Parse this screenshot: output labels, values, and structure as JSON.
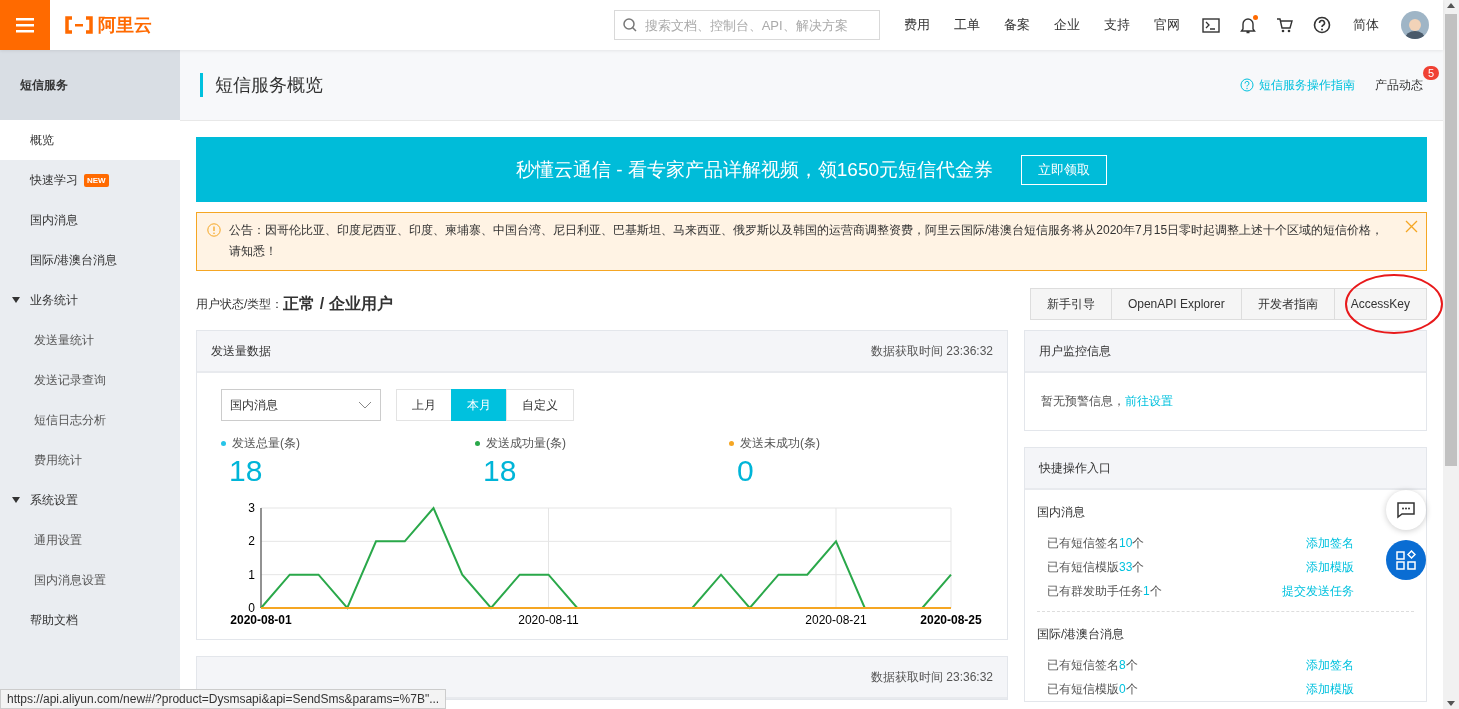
{
  "topbar": {
    "logo": "阿里云",
    "search": {
      "placeholder": "搜索文档、控制台、API、解决方案"
    },
    "nav": [
      "费用",
      "工单",
      "备案",
      "企业",
      "支持",
      "官网"
    ],
    "bell_has_notification": true,
    "language": "简体"
  },
  "sidebar": {
    "title": "短信服务",
    "items": [
      {
        "kind": "link",
        "label": "概览",
        "selected": true
      },
      {
        "kind": "link",
        "label": "快速学习",
        "badge": "NEW",
        "selected": false
      },
      {
        "kind": "link",
        "label": "国内消息",
        "selected": false
      },
      {
        "kind": "link",
        "label": "国际/港澳台消息",
        "selected": false
      },
      {
        "kind": "group",
        "label": "业务统计",
        "expanded": true,
        "children": [
          {
            "label": "发送量统计",
            "selected": false
          },
          {
            "label": "发送记录查询",
            "selected": false
          },
          {
            "label": "短信日志分析",
            "selected": false
          },
          {
            "label": "费用统计",
            "selected": false
          }
        ]
      },
      {
        "kind": "group",
        "label": "系统设置",
        "expanded": true,
        "children": [
          {
            "label": "通用设置",
            "selected": false
          },
          {
            "label": "国内消息设置",
            "selected": false
          }
        ]
      },
      {
        "kind": "link",
        "label": "帮助文档",
        "selected": false
      }
    ]
  },
  "page_header": {
    "title": "短信服务概览",
    "guide_link": "短信服务操作指南",
    "news": {
      "label": "产品动态",
      "badge": "5"
    }
  },
  "banner": {
    "text": "秒懂云通信 - 看专家产品详解视频，领1650元短信代金券",
    "button": "立即领取"
  },
  "notice": {
    "text": "公告：因哥伦比亚、印度尼西亚、印度、柬埔寨、中国台湾、尼日利亚、巴基斯坦、马来西亚、俄罗斯以及韩国的运营商调整资费，阿里云国际/港澳台短信服务将从2020年7月15日零时起调整上述十个区域的短信价格，请知悉！"
  },
  "user_status": {
    "label": "用户状态/类型：",
    "value": "正常 / 企业用户"
  },
  "quick_buttons": [
    "新手引导",
    "OpenAPI Explorer",
    "开发者指南",
    "AccessKey"
  ],
  "send_panel": {
    "title": "发送量数据",
    "fetch_time": "数据获取时间 23:36:32",
    "select": {
      "value": "国内消息"
    },
    "periods": [
      {
        "label": "上月",
        "selected": false
      },
      {
        "label": "本月",
        "selected": true
      },
      {
        "label": "自定义",
        "selected": false
      }
    ],
    "stats": [
      {
        "label": "发送总量(条)",
        "value": "18",
        "color": "#27c4e8"
      },
      {
        "label": "发送成功量(条)",
        "value": "18",
        "color": "#2aa84a"
      },
      {
        "label": "发送未成功(条)",
        "value": "0",
        "color": "#f5a623"
      }
    ],
    "chart_data": {
      "type": "line",
      "categories": [
        "2020-08-01",
        null,
        null,
        null,
        null,
        null,
        null,
        null,
        null,
        null,
        "2020-08-11",
        null,
        null,
        null,
        null,
        null,
        null,
        null,
        null,
        null,
        "2020-08-21",
        null,
        null,
        null,
        "2020-08-25"
      ],
      "grid": true,
      "series": [
        {
          "color": "#2aa84a",
          "values": [
            0,
            1,
            1,
            0,
            2,
            2,
            3,
            1,
            0,
            1,
            1,
            0,
            0,
            0,
            0,
            0,
            1,
            0,
            1,
            1,
            2,
            0,
            0,
            0,
            1
          ]
        },
        {
          "color": "#f5a623",
          "values": [
            0,
            0,
            0,
            0,
            0,
            0,
            0,
            0,
            0,
            0,
            0,
            0,
            0,
            0,
            0,
            0,
            0,
            0,
            0,
            0,
            0,
            0,
            0,
            0,
            0
          ]
        }
      ],
      "ylim": [
        0,
        3
      ],
      "yticks": [
        0,
        1,
        2,
        3
      ]
    }
  },
  "monitor_panel": {
    "title": "用户监控信息",
    "text": "暂无预警信息，",
    "link": "前往设置"
  },
  "quick_panel": {
    "title": "快捷操作入口",
    "sections": [
      {
        "title": "国内消息",
        "rows": [
          {
            "prefix": "已有短信签名",
            "count": "10",
            "suffix": "个",
            "action": "添加签名"
          },
          {
            "prefix": "已有短信模版",
            "count": "33",
            "suffix": "个",
            "action": "添加模版"
          },
          {
            "prefix": "已有群发助手任务",
            "count": "1",
            "suffix": "个",
            "action": "提交发送任务"
          }
        ]
      },
      {
        "title": "国际/港澳台消息",
        "rows": [
          {
            "prefix": "已有短信签名",
            "count": "8",
            "suffix": "个",
            "action": "添加签名"
          },
          {
            "prefix": "已有短信模版",
            "count": "0",
            "suffix": "个",
            "action": "添加模版"
          }
        ]
      }
    ]
  },
  "bottom_panel": {
    "fetch_time": "数据获取时间 23:36:32"
  },
  "status_bar": "https://api.aliyun.com/new#/?product=Dysmsapi&api=SendSms&params=%7B\"..."
}
